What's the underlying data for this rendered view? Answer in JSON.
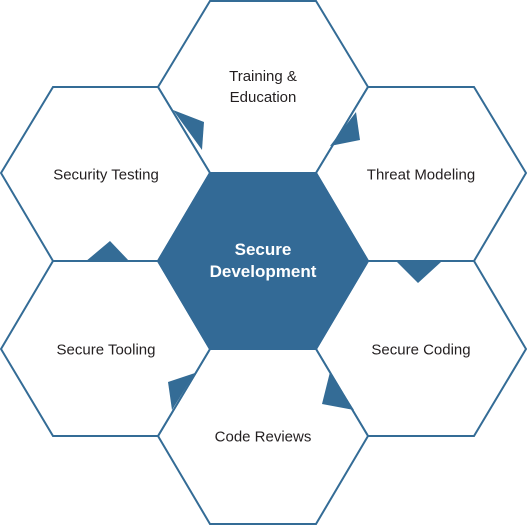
{
  "diagram": {
    "center": {
      "line1": "Secure",
      "line2": "Development"
    },
    "nodes": {
      "training": {
        "line1": "Training &",
        "line2": "Education"
      },
      "threat_modeling": "Threat Modeling",
      "secure_coding": "Secure Coding",
      "code_reviews": "Code Reviews",
      "secure_tooling": "Secure Tooling",
      "security_testing": "Security Testing"
    },
    "colors": {
      "accent": "#336a96",
      "outline": "#346c96",
      "center_text": "#ffffff",
      "label_text": "#231f20"
    }
  }
}
